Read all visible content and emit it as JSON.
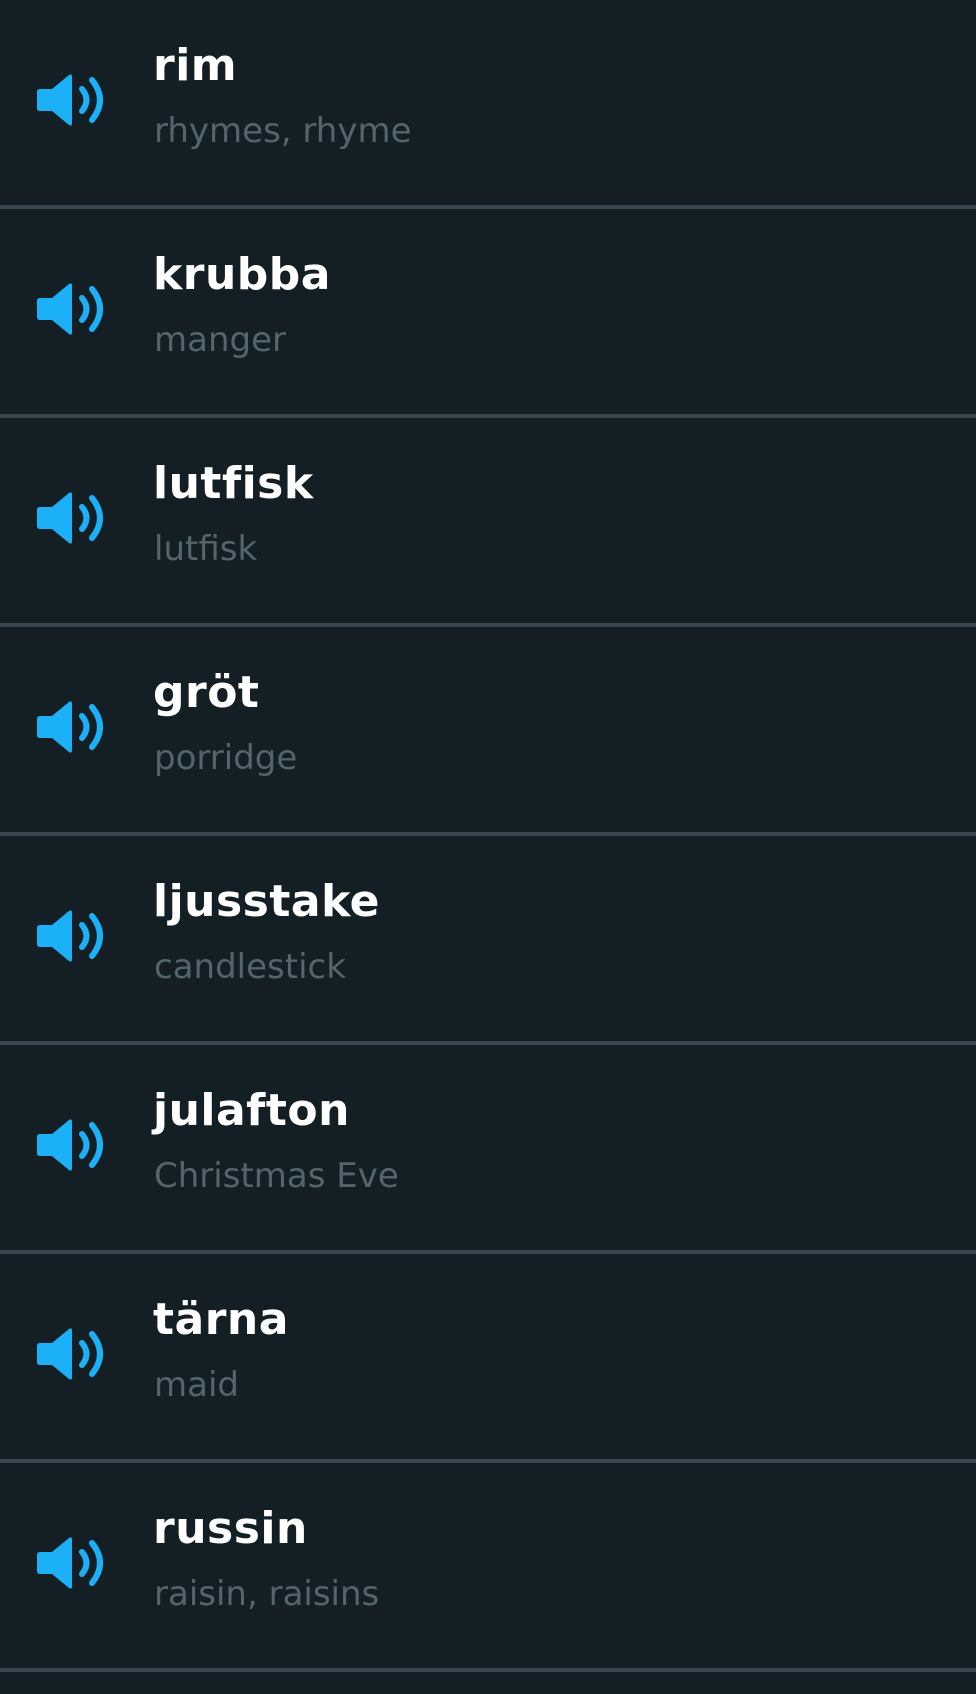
{
  "accent_color": "#1cb0f6",
  "speaker_icon": "speaker-icon",
  "words": [
    {
      "word": "rim",
      "translation": "rhymes, rhyme"
    },
    {
      "word": "krubba",
      "translation": "manger"
    },
    {
      "word": "lutfisk",
      "translation": "lutfisk"
    },
    {
      "word": "gröt",
      "translation": "porridge"
    },
    {
      "word": "ljusstake",
      "translation": "candlestick"
    },
    {
      "word": "julafton",
      "translation": "Christmas Eve"
    },
    {
      "word": "tärna",
      "translation": "maid"
    },
    {
      "word": "russin",
      "translation": "raisin, raisins"
    }
  ]
}
